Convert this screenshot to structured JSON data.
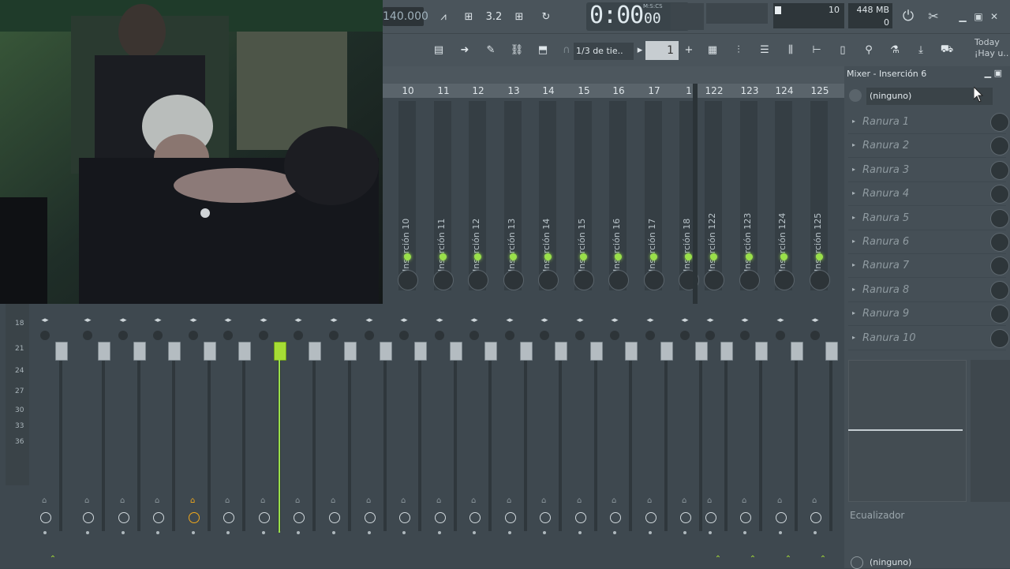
{
  "toolbar": {
    "tempo": "140.000",
    "time_main": "0:00",
    "time_ms": "00",
    "time_units": "M:S:CS",
    "cpu_value": "10",
    "memory": "448 MB",
    "polyphony": "0",
    "snap_label": "1/3 de tie..",
    "pattern_number": "1",
    "news_line1": "Today",
    "news_line2": "¡Hay u.."
  },
  "mixer": {
    "track_numbers": [
      "10",
      "11",
      "12",
      "13",
      "14",
      "15",
      "16",
      "17",
      "1",
      "122",
      "123",
      "124",
      "125"
    ],
    "track_names": [
      "Inserción 10",
      "Inserción 11",
      "Inserción 12",
      "Inserción 13",
      "Inserción 14",
      "Inserción 15",
      "Inserción 16",
      "Inserción 17",
      "Inserción 18",
      "Inserción 122",
      "Inserción 123",
      "Inserción 124",
      "Inserción 125"
    ],
    "db_scale": [
      "18",
      "21",
      "24",
      "27",
      "30",
      "33",
      "36"
    ]
  },
  "panel": {
    "title": "Mixer - Inserción 6",
    "input_select": "(ninguno)",
    "slots": [
      "Ranura 1",
      "Ranura 2",
      "Ranura 3",
      "Ranura 4",
      "Ranura 5",
      "Ranura 6",
      "Ranura 7",
      "Ranura 8",
      "Ranura 9",
      "Ranura 10"
    ],
    "eq_label": "Ecualizador",
    "output_select": "(ninguno)"
  },
  "colors": {
    "accent_green": "#9ae04a",
    "selected_fader": "#a6dd35",
    "highlight_orange": "#f0a81c"
  }
}
